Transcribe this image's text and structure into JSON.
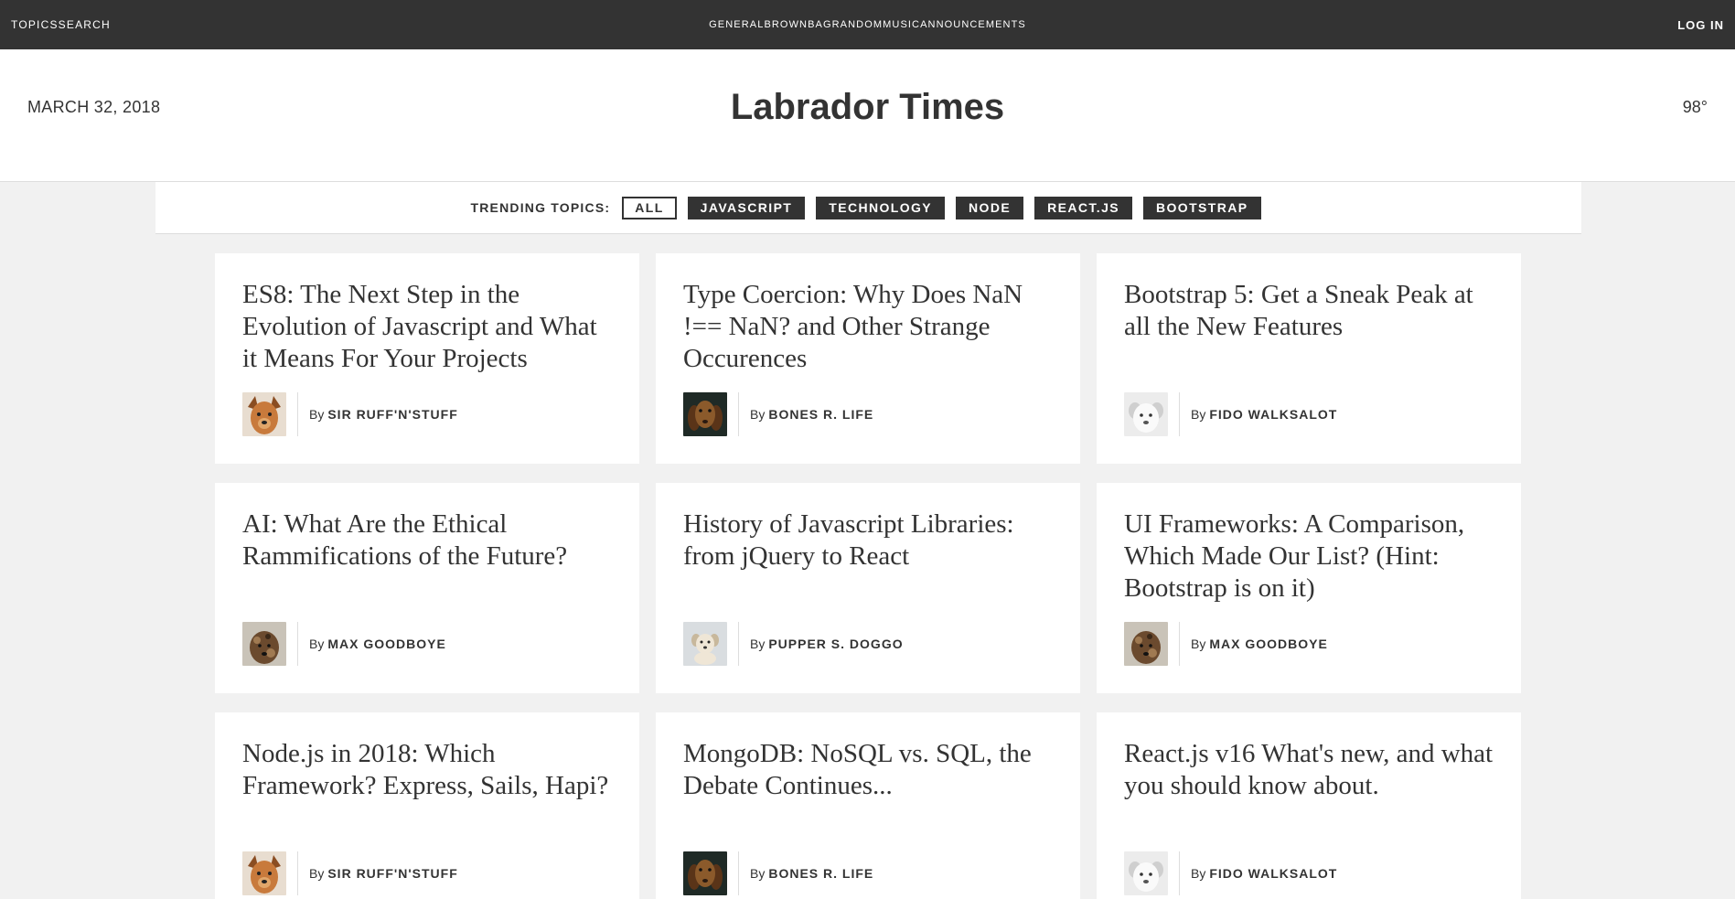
{
  "nav": {
    "left": [
      "TOPICS",
      "SEARCH"
    ],
    "center": [
      "GENERAL",
      "BROWN",
      "BAG",
      "RANDOM",
      "MUSIC",
      "ANNOUNCEMENTS"
    ],
    "login": "LOG IN"
  },
  "masthead": {
    "date": "MARCH 32, 2018",
    "title": "Labrador Times",
    "temperature": "98°"
  },
  "trending": {
    "label": "TRENDING TOPICS:",
    "tags": [
      "ALL",
      "JAVASCRIPT",
      "TECHNOLOGY",
      "NODE",
      "REACT.JS",
      "BOOTSTRAP"
    ],
    "active": "ALL"
  },
  "byline_prefix": "By",
  "articles": [
    {
      "title": "ES8: The Next Step in the Evolution of Javascript and What it Means For Your Projects",
      "author": "SIR RUFF'N'STUFF",
      "avatar": "orange-puppy"
    },
    {
      "title": "Type Coercion: Why Does NaN !== NaN? and Other Strange Occurences",
      "author": "BONES R. LIFE",
      "avatar": "brown-dog"
    },
    {
      "title": "Bootstrap 5: Get a Sneak Peak at all the New Features",
      "author": "FIDO WALKSALOT",
      "avatar": "white-dog"
    },
    {
      "title": "AI: What Are the Ethical Rammifications of the Future?",
      "author": "MAX GOODBOYE",
      "avatar": "spotted-dog"
    },
    {
      "title": "History of Javascript Libraries: from jQuery to React",
      "author": "PUPPER S. DOGGO",
      "avatar": "cream-puppy"
    },
    {
      "title": "UI Frameworks: A Comparison, Which Made Our List? (Hint: Bootstrap is on it)",
      "author": "MAX GOODBOYE",
      "avatar": "spotted-dog"
    },
    {
      "title": "Node.js in 2018: Which Framework? Express, Sails, Hapi?",
      "author": "SIR RUFF'N'STUFF",
      "avatar": "orange-puppy"
    },
    {
      "title": "MongoDB: NoSQL vs. SQL, the Debate Continues...",
      "author": "BONES R. LIFE",
      "avatar": "brown-dog"
    },
    {
      "title": "React.js v16 What's new, and what you should know about.",
      "author": "FIDO WALKSALOT",
      "avatar": "white-dog"
    }
  ],
  "colors": {
    "topbar": "#333333",
    "page_bg": "#f1f1f1",
    "tag_bg": "#333333"
  }
}
